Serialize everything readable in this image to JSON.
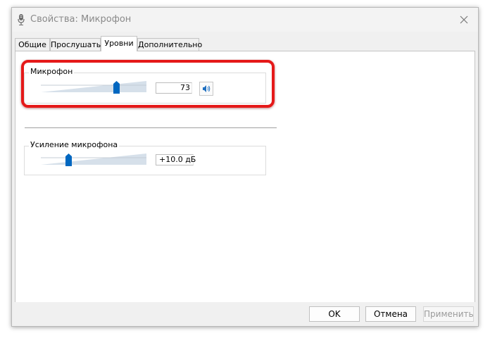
{
  "window": {
    "title": "Свойства: Микрофон"
  },
  "tabs": [
    {
      "label": "Общие"
    },
    {
      "label": "Прослушать"
    },
    {
      "label": "Уровни",
      "active": true
    },
    {
      "label": "Дополнительно"
    }
  ],
  "levels": {
    "microphone": {
      "label": "Микрофон",
      "value": "73",
      "level_percent": 73,
      "mute_icon": "speaker-icon"
    },
    "boost": {
      "label": "Усиление микрофона",
      "value": "+10.0 дБ",
      "level_fraction": 0.25
    }
  },
  "footer": {
    "ok_label": "OK",
    "cancel_label": "Отмена",
    "apply_label": "Применить"
  },
  "colors": {
    "accent": "#0067c0",
    "highlight": "#e51919",
    "track": "#cfdbe8"
  }
}
